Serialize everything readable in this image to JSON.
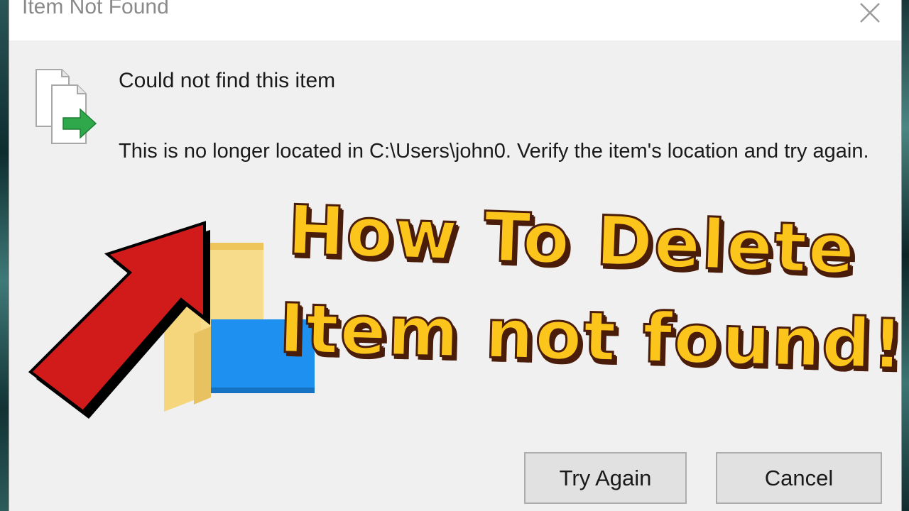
{
  "dialog": {
    "title": "Item Not Found",
    "close_icon": "close-icon",
    "heading": "Could not find this item",
    "message": "This is no longer located in C:\\Users\\john0. Verify the item's location and try again.",
    "file_icon": "file-move-icon",
    "buttons": {
      "try_again": "Try Again",
      "cancel": "Cancel"
    }
  },
  "overlay": {
    "line1": "How To Delete",
    "line2": "Item not found!",
    "text_color": "#fcc51c",
    "outline_color": "#4a1d0a",
    "arrow_icon": "red-arrow-icon",
    "arrow_color": "#d11b1b",
    "folder_icon": "folder-icon"
  },
  "colors": {
    "dialog_bg": "#f0f0f0",
    "titlebar_bg": "#ffffff",
    "button_bg": "#e1e1e1"
  }
}
